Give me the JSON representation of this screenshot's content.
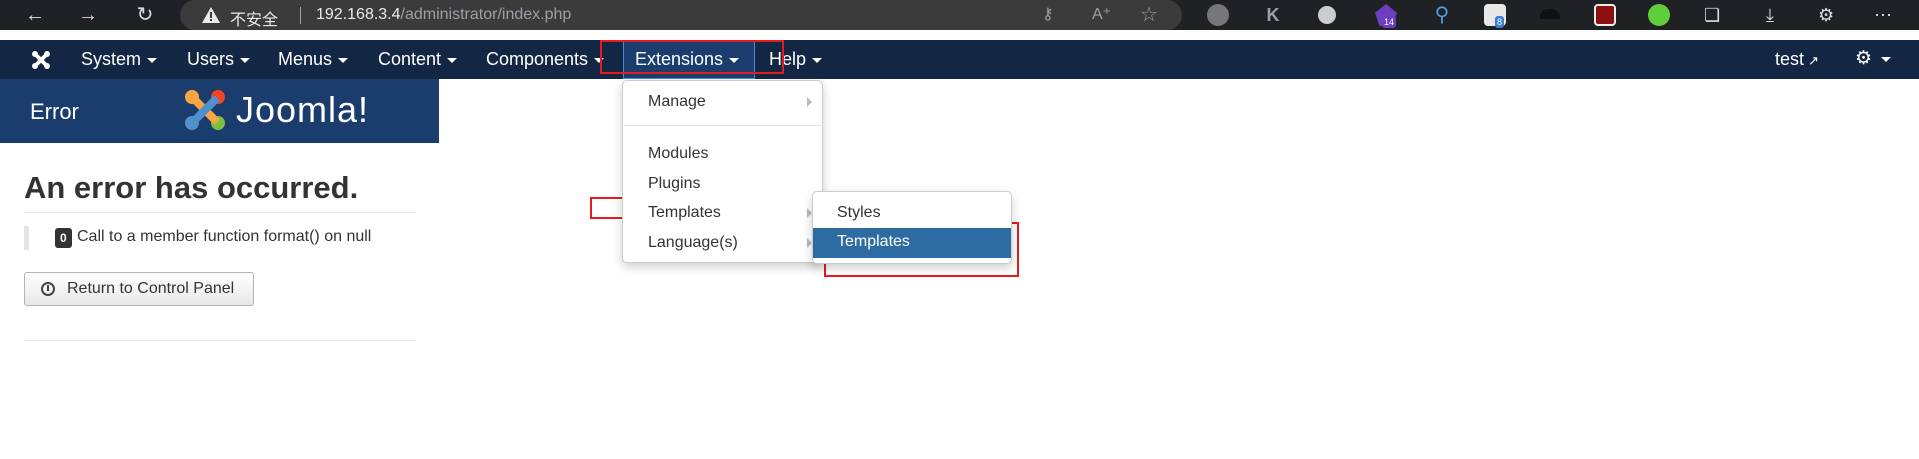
{
  "browser": {
    "security_label": "不安全",
    "url_host": "192.168.3.4",
    "url_path": "/administrator/index.php",
    "badges": {
      "ext1": "14",
      "ext2": "8"
    }
  },
  "navbar": {
    "items": [
      {
        "label": "System"
      },
      {
        "label": "Users"
      },
      {
        "label": "Menus"
      },
      {
        "label": "Content"
      },
      {
        "label": "Components"
      },
      {
        "label": "Extensions"
      },
      {
        "label": "Help"
      }
    ],
    "user_label": "test"
  },
  "header": {
    "title": "Error",
    "brand": "Joomla!"
  },
  "error": {
    "heading": "An error has occurred.",
    "code": "0",
    "message": "Call to a member function format() on null",
    "return_label": "Return to Control Panel"
  },
  "extensions_menu": {
    "items": [
      {
        "label": "Manage"
      },
      {
        "label": "Modules"
      },
      {
        "label": "Plugins"
      },
      {
        "label": "Templates"
      },
      {
        "label": "Language(s)"
      }
    ]
  },
  "templates_submenu": {
    "items": [
      {
        "label": "Styles"
      },
      {
        "label": "Templates"
      }
    ]
  },
  "colors": {
    "navbar": "#132745",
    "header": "#1b3d6e",
    "highlight": "#2d6ca2",
    "annotation": "#e31c1c"
  }
}
